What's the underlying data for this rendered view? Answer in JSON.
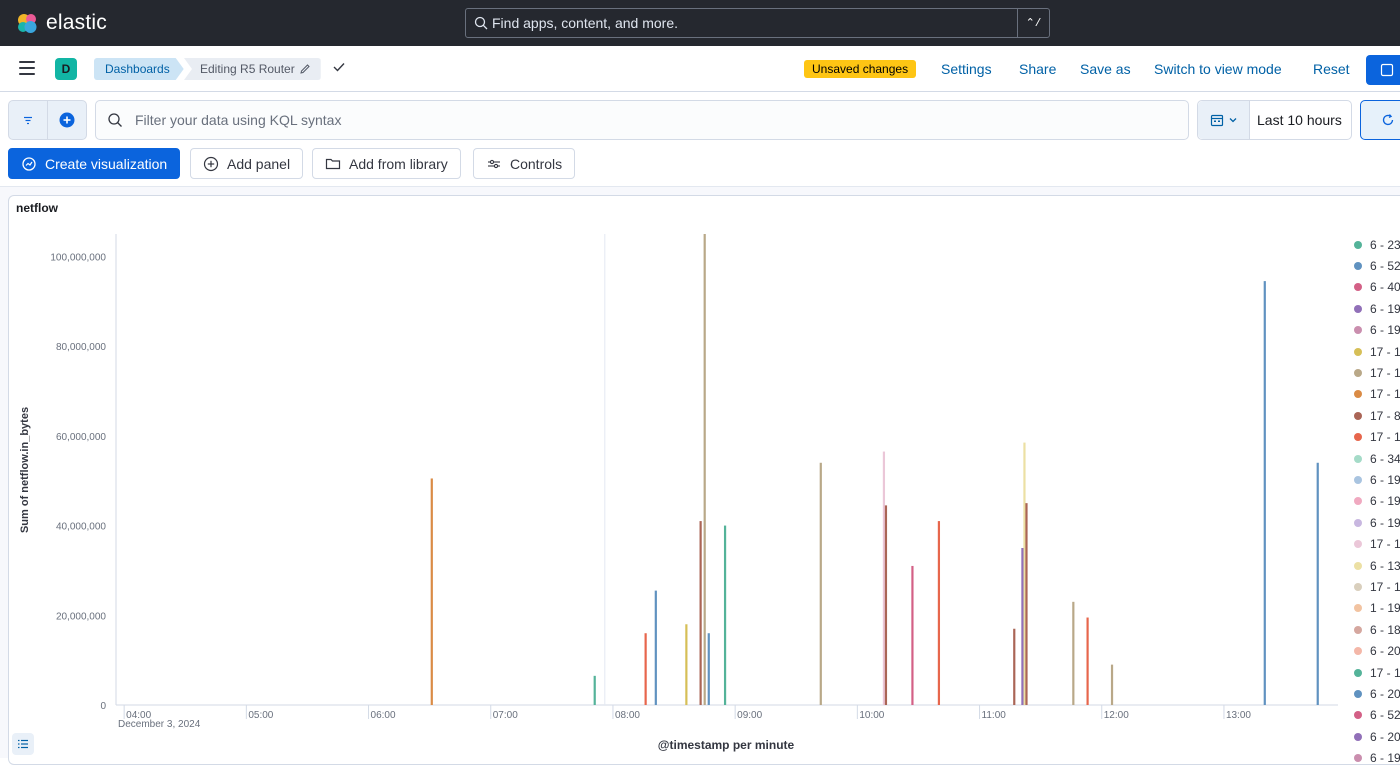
{
  "header": {
    "brand": "elastic",
    "search_placeholder": "Find apps, content, and more.",
    "shortcut": "⌃/"
  },
  "nav": {
    "space_initial": "D",
    "breadcrumbs": [
      "Dashboards",
      "Editing R5 Router"
    ],
    "unsaved_badge": "Unsaved changes",
    "links": [
      "Settings",
      "Share",
      "Save as",
      "Switch to view mode",
      "Reset"
    ]
  },
  "query": {
    "placeholder": "Filter your data using KQL syntax",
    "time_range": "Last 10 hours"
  },
  "toolbar": {
    "create_visualization": "Create visualization",
    "add_panel": "Add panel",
    "add_from_library": "Add from library",
    "controls": "Controls"
  },
  "panel": {
    "title": "netflow"
  },
  "colors": {
    "accent": "#0b64dd",
    "header_bg": "#25282f",
    "unsaved": "#fec514"
  },
  "chart_data": {
    "type": "bar",
    "stacked": true,
    "ylabel": "Sum of netflow.in_bytes",
    "xlabel": "@timestamp per minute",
    "x_start_label": "December 3, 2024",
    "ylim": [
      0,
      105000000
    ],
    "yticks": [
      {
        "value": 0,
        "label": "0"
      },
      {
        "value": 20000000,
        "label": "20,000,000"
      },
      {
        "value": 40000000,
        "label": "40,000,000"
      },
      {
        "value": 60000000,
        "label": "60,000,000"
      },
      {
        "value": 80000000,
        "label": "80,000,000"
      },
      {
        "value": 100000000,
        "label": "100,000,000"
      }
    ],
    "xlim": [
      "03:56",
      "13:56"
    ],
    "xticks": [
      "04:00",
      "05:00",
      "06:00",
      "07:00",
      "08:00",
      "09:00",
      "10:00",
      "11:00",
      "12:00",
      "13:00"
    ],
    "grid": false,
    "legend_position": "right",
    "series_legend": [
      {
        "name": "6 - 23",
        "color": "#54b399"
      },
      {
        "name": "6 - 52",
        "color": "#6092c0"
      },
      {
        "name": "6 - 40",
        "color": "#d36086"
      },
      {
        "name": "6 - 19",
        "color": "#9170b8"
      },
      {
        "name": "6 - 19",
        "color": "#ca8eae"
      },
      {
        "name": "17 - 1",
        "color": "#d6bf57"
      },
      {
        "name": "17 - 1",
        "color": "#b9a888"
      },
      {
        "name": "17 - 1",
        "color": "#da8b45"
      },
      {
        "name": "17 - 8",
        "color": "#aa6556"
      },
      {
        "name": "17 - 1",
        "color": "#e7664c"
      },
      {
        "name": "6 - 34",
        "color": "#a5dbc8"
      },
      {
        "name": "6 - 19",
        "color": "#a9c4e0"
      },
      {
        "name": "6 - 19",
        "color": "#f0a9c0"
      },
      {
        "name": "6 - 19",
        "color": "#c8b7e0"
      },
      {
        "name": "17 - 1",
        "color": "#ebc7d8"
      },
      {
        "name": "6 - 13",
        "color": "#ece0a4"
      },
      {
        "name": "17 - 1",
        "color": "#d9cfbd"
      },
      {
        "name": "1 - 19",
        "color": "#f2c3a1"
      },
      {
        "name": "6 - 18",
        "color": "#d5a79f"
      },
      {
        "name": "6 - 20",
        "color": "#f4b7a8"
      },
      {
        "name": "17 - 1",
        "color": "#54b399"
      },
      {
        "name": "6 - 20",
        "color": "#6092c0"
      },
      {
        "name": "6 - 52",
        "color": "#d36086"
      },
      {
        "name": "6 - 20",
        "color": "#9170b8"
      },
      {
        "name": "6 - 19",
        "color": "#ca8eae"
      }
    ],
    "spikes": [
      {
        "t": "06:31",
        "value": 50500000,
        "color": "#da8b45"
      },
      {
        "t": "07:51",
        "value": 6500000,
        "color": "#54b399"
      },
      {
        "t": "08:16",
        "value": 16000000,
        "color": "#e7664c"
      },
      {
        "t": "08:21",
        "value": 25500000,
        "color": "#6092c0"
      },
      {
        "t": "08:36",
        "value": 18000000,
        "color": "#d6bf57"
      },
      {
        "t": "08:43",
        "value": 41000000,
        "color": "#aa6556"
      },
      {
        "t": "08:45",
        "value": 105000000,
        "color": "#b9a888"
      },
      {
        "t": "08:47",
        "value": 16000000,
        "color": "#6092c0"
      },
      {
        "t": "08:55",
        "value": 40000000,
        "color": "#54b399"
      },
      {
        "t": "09:42",
        "value": 54000000,
        "color": "#b9a888"
      },
      {
        "t": "10:13",
        "value": 56500000,
        "color": "#ebc7d8"
      },
      {
        "t": "10:14",
        "value": 44500000,
        "color": "#aa6556"
      },
      {
        "t": "10:27",
        "value": 31000000,
        "color": "#d36086"
      },
      {
        "t": "10:40",
        "value": 41000000,
        "color": "#e7664c"
      },
      {
        "t": "11:17",
        "value": 17000000,
        "color": "#aa6556"
      },
      {
        "t": "11:22",
        "value": 58500000,
        "color": "#ece0a4"
      },
      {
        "t": "11:23",
        "value": 45000000,
        "color": "#aa6556"
      },
      {
        "t": "11:21",
        "value": 35000000,
        "color": "#9170b8"
      },
      {
        "t": "11:46",
        "value": 23000000,
        "color": "#b9a888"
      },
      {
        "t": "11:53",
        "value": 19500000,
        "color": "#e7664c"
      },
      {
        "t": "12:05",
        "value": 9000000,
        "color": "#b9a888"
      },
      {
        "t": "13:20",
        "value": 94500000,
        "color": "#6092c0"
      },
      {
        "t": "13:46",
        "value": 54000000,
        "color": "#6092c0"
      }
    ]
  }
}
